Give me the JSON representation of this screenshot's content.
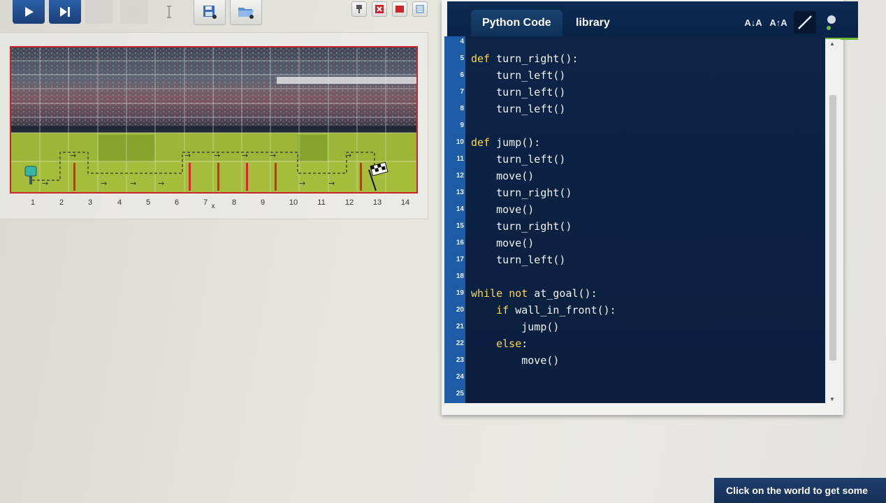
{
  "toolbar": {
    "run_icon": "play-icon",
    "step_icon": "step-forward-icon",
    "pause_icon": "pause-icon",
    "stop_icon": "stop-icon",
    "save_icon": "save-icon",
    "open_icon": "open-folder-icon",
    "right_buttons": [
      "robot-icon",
      "close-x-icon",
      "flag-icon",
      "list-icon"
    ]
  },
  "world": {
    "column_labels": [
      "1",
      "2",
      "3",
      "4",
      "5",
      "6",
      "7",
      "8",
      "9",
      "10",
      "11",
      "12",
      "13",
      "14"
    ],
    "cursor_mark": "x"
  },
  "editor": {
    "tabs": [
      "Python Code",
      "library"
    ],
    "active_tab": 0,
    "font_smaller": "A↓A",
    "font_larger": "A↑A",
    "lines": [
      {
        "n": "4",
        "code": ""
      },
      {
        "n": "5",
        "code": "def turn_right():"
      },
      {
        "n": "6",
        "code": "    turn_left()"
      },
      {
        "n": "7",
        "code": "    turn_left()"
      },
      {
        "n": "8",
        "code": "    turn_left()"
      },
      {
        "n": "9",
        "code": ""
      },
      {
        "n": "10",
        "code": "def jump():"
      },
      {
        "n": "11",
        "code": "    turn_left()"
      },
      {
        "n": "12",
        "code": "    move()"
      },
      {
        "n": "13",
        "code": "    turn_right()"
      },
      {
        "n": "14",
        "code": "    move()"
      },
      {
        "n": "15",
        "code": "    turn_right()"
      },
      {
        "n": "16",
        "code": "    move()"
      },
      {
        "n": "17",
        "code": "    turn_left()"
      },
      {
        "n": "18",
        "code": ""
      },
      {
        "n": "19",
        "code": "while not at_goal():"
      },
      {
        "n": "20",
        "code": "    if wall_in_front():"
      },
      {
        "n": "21",
        "code": "        jump()"
      },
      {
        "n": "22",
        "code": "    else:"
      },
      {
        "n": "23",
        "code": "        move()"
      },
      {
        "n": "24",
        "code": ""
      },
      {
        "n": "25",
        "code": ""
      }
    ]
  },
  "status": {
    "text": "Click on the world to get some"
  },
  "colors": {
    "accent_blue": "#1b3f78",
    "editor_bg": "#0b1f3e",
    "gutter": "#1f5ca8",
    "keyword": "#ffd84d",
    "tab_underline": "#6cbc3a",
    "world_border": "#c6262c"
  }
}
